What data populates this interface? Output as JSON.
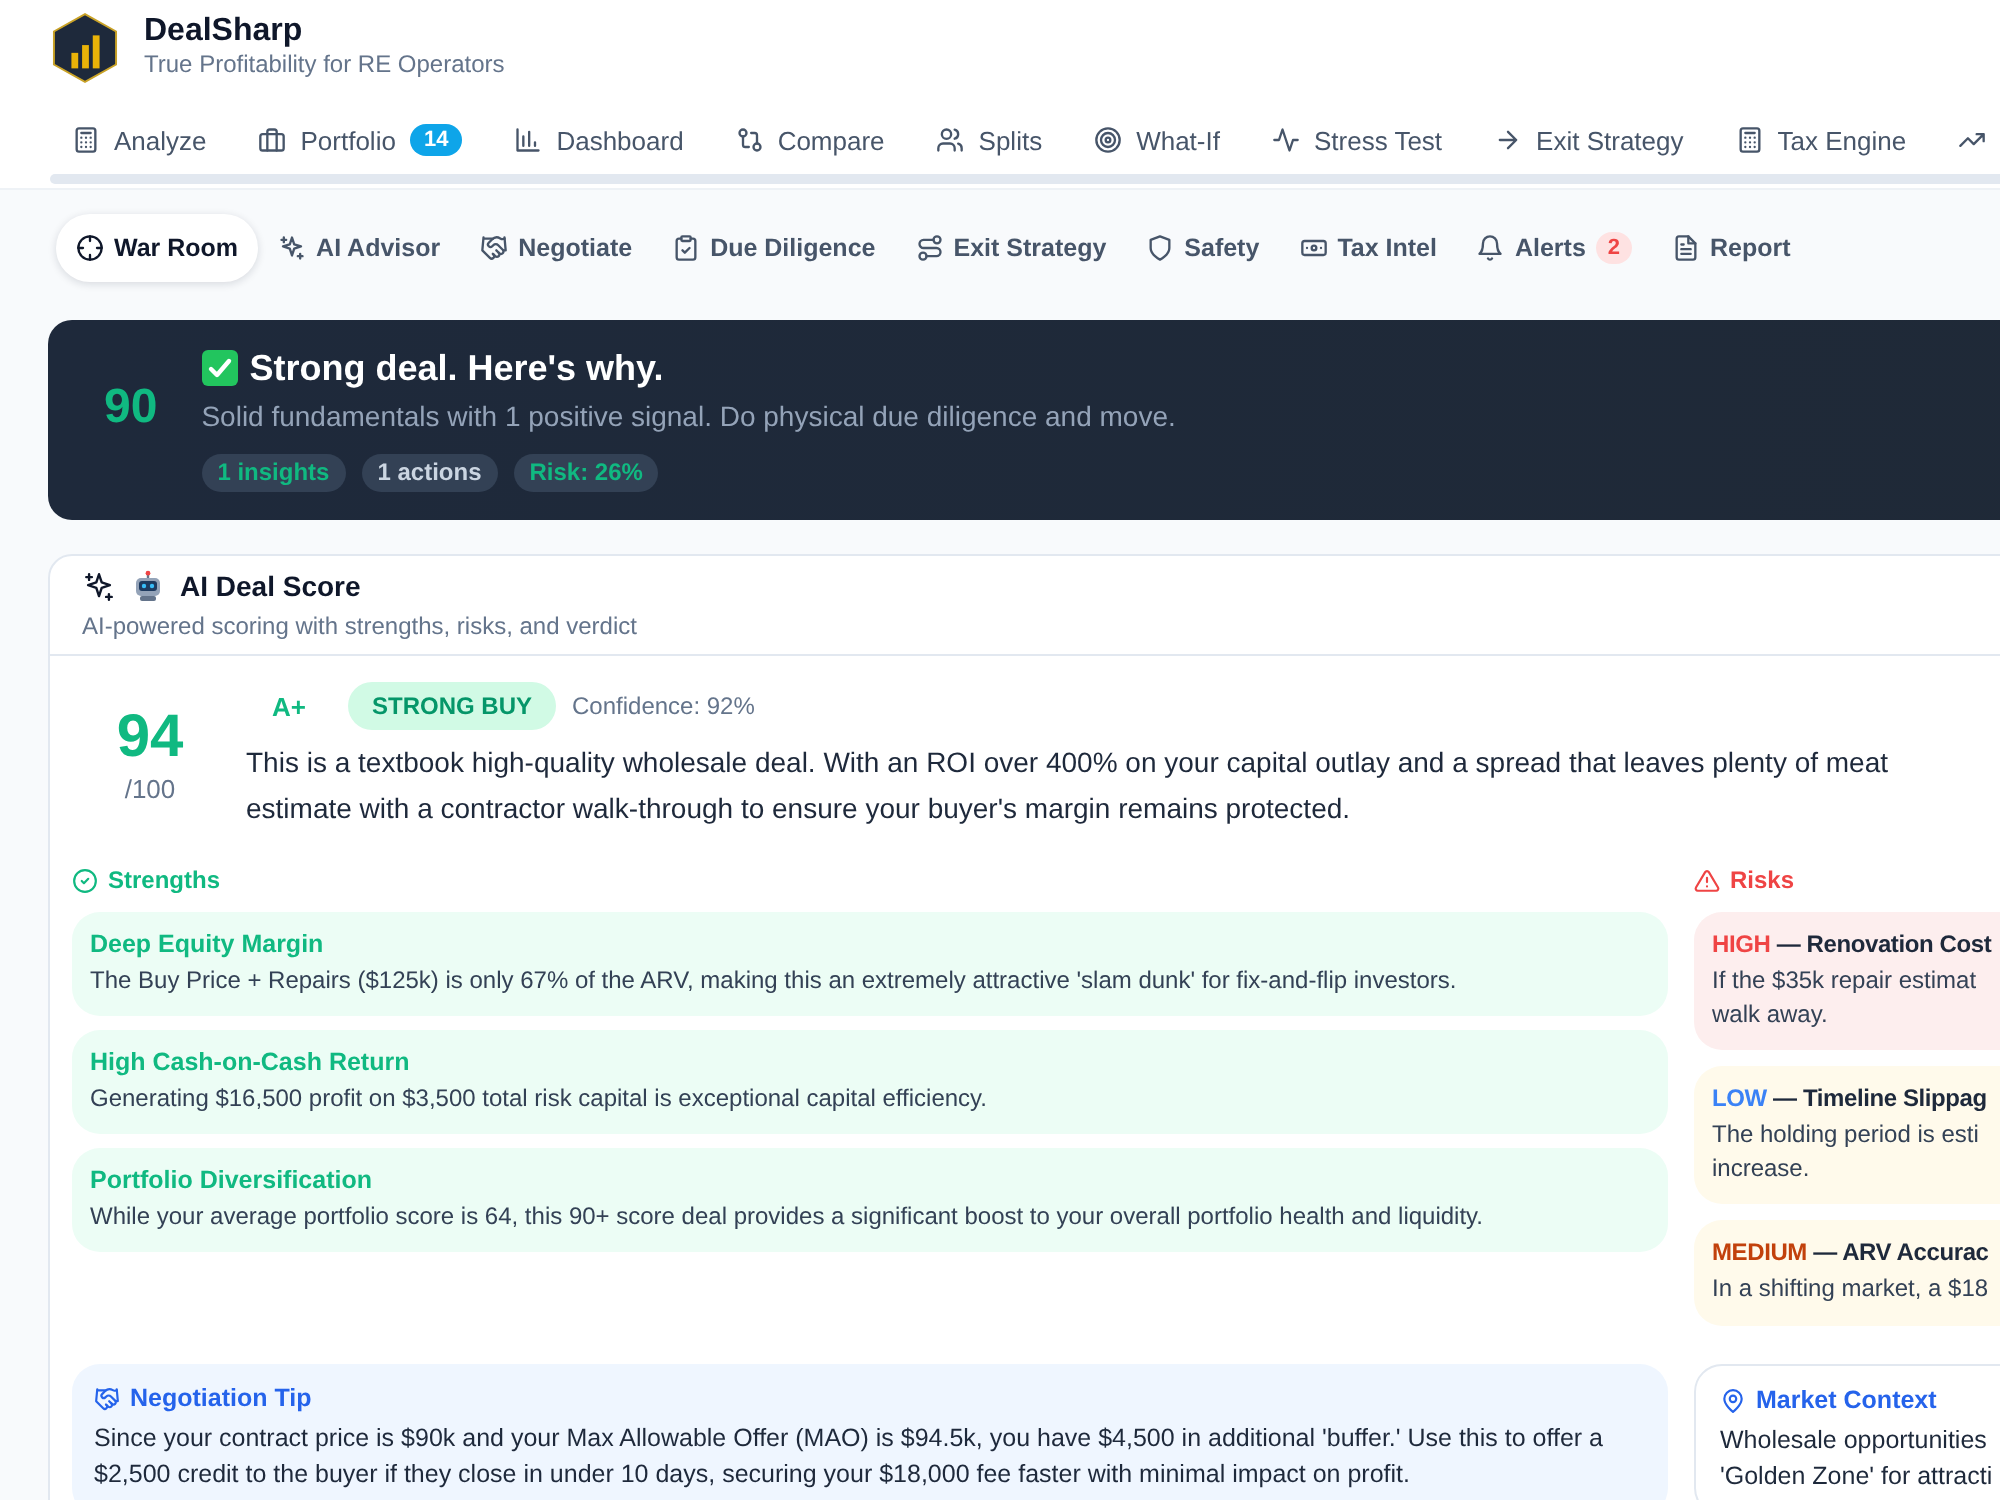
{
  "app": {
    "name": "DealSharp",
    "tagline": "True Profitability for RE Operators"
  },
  "main_nav": [
    {
      "label": "Analyze"
    },
    {
      "label": "Portfolio",
      "badge": "14"
    },
    {
      "label": "Dashboard"
    },
    {
      "label": "Compare"
    },
    {
      "label": "Splits"
    },
    {
      "label": "What-If"
    },
    {
      "label": "Stress Test"
    },
    {
      "label": "Exit Strategy"
    },
    {
      "label": "Tax Engine"
    }
  ],
  "sub_tabs": [
    {
      "label": "War Room",
      "selected": true
    },
    {
      "label": "AI Advisor",
      "selected": false
    },
    {
      "label": "Negotiate",
      "selected": false
    },
    {
      "label": "Due Diligence",
      "selected": false
    },
    {
      "label": "Exit Strategy",
      "selected": false
    },
    {
      "label": "Safety",
      "selected": false
    },
    {
      "label": "Tax Intel",
      "selected": false
    },
    {
      "label": "Alerts",
      "selected": false,
      "badge": "2"
    },
    {
      "label": "Report",
      "selected": false
    }
  ],
  "summary_banner": {
    "score": "90",
    "title": "Strong deal. Here's why.",
    "subtitle": "Solid fundamentals with 1 positive signal. Do physical due diligence and move.",
    "chips": [
      {
        "text": "1 insights",
        "color": "#10b981"
      },
      {
        "text": "1 actions",
        "color": "#cbd5e1"
      },
      {
        "text": "Risk: 26%",
        "color": "#10b981"
      }
    ]
  },
  "deal_score_card": {
    "title": "AI Deal Score",
    "subtitle": "AI-powered scoring with strengths, risks, and verdict",
    "score": "94",
    "score_max": "/100",
    "grade": "A+",
    "recommendation": "STRONG BUY",
    "confidence": "Confidence: 92%",
    "verdict_lines": [
      "This is a textbook high-quality wholesale deal. With an ROI over 400% on your capital outlay and a spread that leaves plenty of meat",
      "estimate with a contractor walk-through to ensure your buyer's margin remains protected."
    ],
    "strengths": {
      "heading": "Strengths",
      "items": [
        {
          "title": "Deep Equity Margin",
          "description": "The Buy Price + Repairs ($125k) is only 67% of the ARV, making this an extremely attractive 'slam dunk' for fix-and-flip investors."
        },
        {
          "title": "High Cash-on-Cash Return",
          "description": "Generating $16,500 profit on $3,500 total risk capital is exceptional capital efficiency."
        },
        {
          "title": "Portfolio Diversification",
          "description": "While your average portfolio score is 64, this 90+ score deal provides a significant boost to your overall portfolio health and liquidity."
        }
      ]
    },
    "risks": {
      "heading": "Risks",
      "items": [
        {
          "kind": "high",
          "severity_label": "HIGH",
          "title": "— Renovation Cost",
          "description_lines": [
            "If the $35k repair estimat",
            "walk away."
          ]
        },
        {
          "kind": "low",
          "severity_label": "LOW",
          "title": "— Timeline Slippag",
          "description_lines": [
            "The holding period is esti",
            "increase."
          ]
        },
        {
          "kind": "medium",
          "severity_label": "MEDIUM",
          "title": "— ARV Accurac",
          "description_lines": [
            "In a shifting market, a $18"
          ]
        }
      ]
    },
    "negotiation_tip": {
      "title": "Negotiation Tip",
      "text": "Since your contract price is $90k and your Max Allowable Offer (MAO) is $94.5k, you have $4,500 in additional 'buffer.' Use this to offer a $2,500 credit to the buyer if they close in under 10 days, securing your $18,000 fee faster with minimal impact on profit."
    },
    "market_context": {
      "title": "Market Context",
      "lines": [
        "Wholesale opportunities",
        "'Golden Zone' for attracti"
      ]
    }
  }
}
